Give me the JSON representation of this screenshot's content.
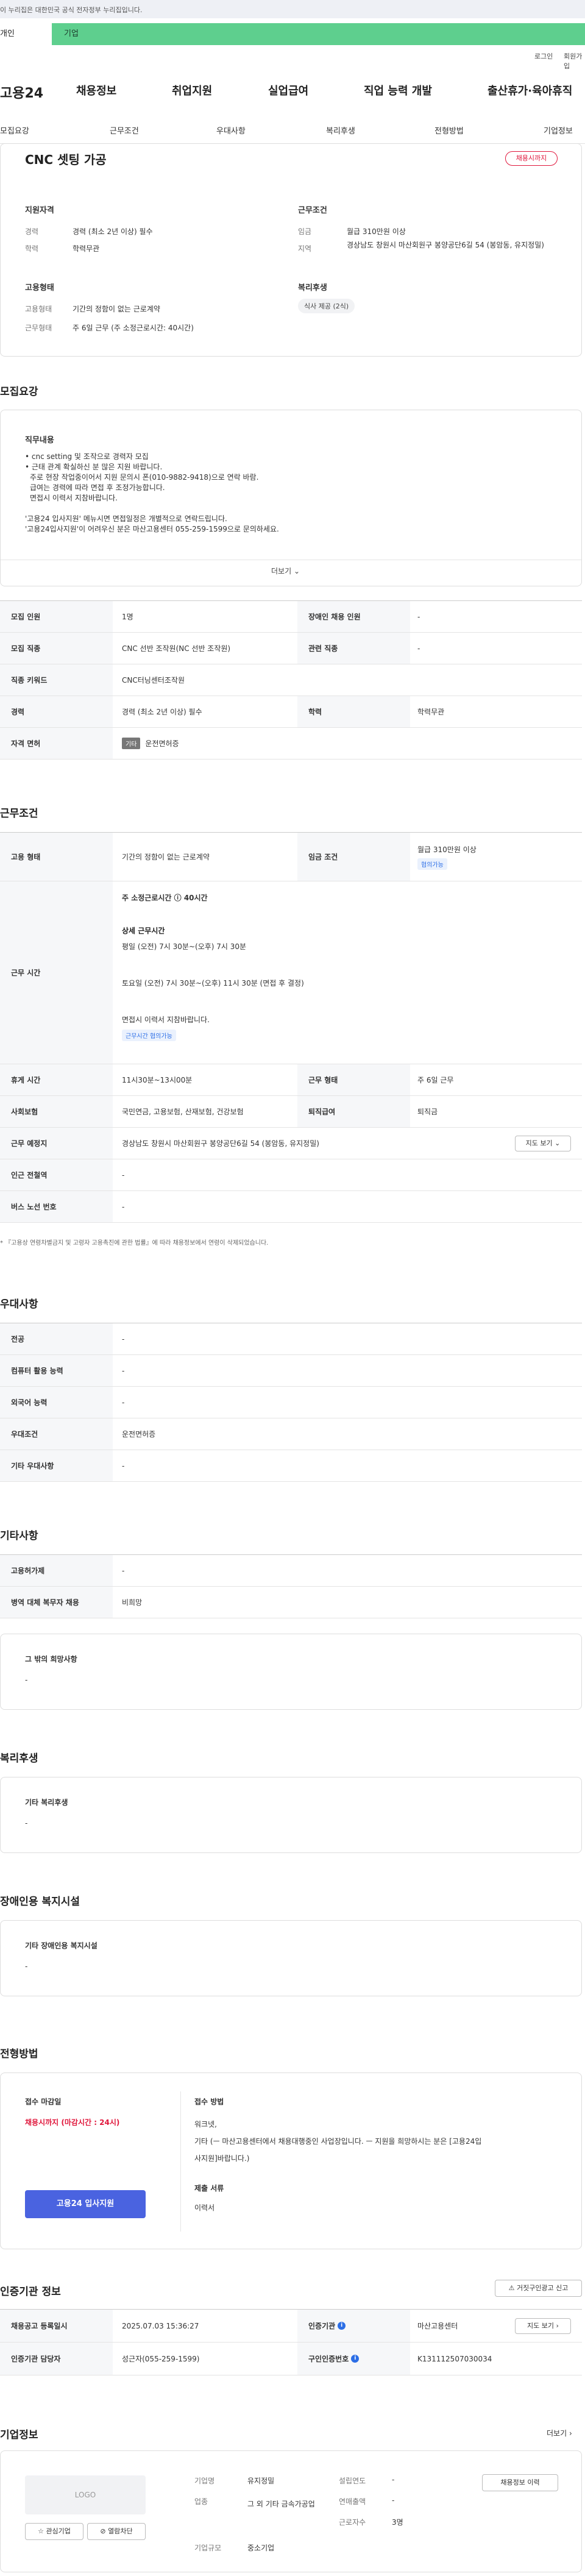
{
  "gov_banner": {
    "text": "이 누리집은 대한민국 공식 전자정부 누리집입니다."
  },
  "segment": {
    "personal": "개인",
    "company": "기업"
  },
  "util": {
    "login": "로그인",
    "join": "회원가입"
  },
  "logo": {
    "text": "고용24"
  },
  "gnb": [
    "채용정보",
    "취업지원",
    "실업급여",
    "직업 능력 개발",
    "출산휴가·육아휴직"
  ],
  "lnb": [
    "모집요강",
    "근무조건",
    "우대사항",
    "복리후생",
    "전형방법",
    "기업정보"
  ],
  "summary": {
    "title": "CNC 셋팅 가공",
    "status_badge": "채용시까지",
    "qual_title": "지원자격",
    "career_label": "경력",
    "career_value": "경력 (최소 2년 이상) 필수",
    "edu_label": "학력",
    "edu_value": "학력무관",
    "cond_title": "근무조건",
    "wage_label": "임금",
    "wage_value": "월급 310만원 이상",
    "region_label": "지역",
    "region_value": "경상남도 창원시 마산회원구 봉양공단6길 54 (봉암동, 유지정밀)",
    "emp_title": "고용형태",
    "emptype_label": "고용형태",
    "emptype_value": "기간의 정함이 없는 근로계약",
    "worktype_label": "근무형태",
    "worktype_value": "주 6일 근무 (주 소정근로시간: 40시간)",
    "welfare_title": "복리후생",
    "welfare_chip": "식사 제공 (2식)"
  },
  "recruit": {
    "heading": "모집요강",
    "duty_title": "직무내용",
    "duty_lines": [
      "• cnc setting 및 조작으로 경력자 모집",
      "• 근태 관계 확실하신 분 많은 지원 바랍니다.",
      "  주로 현장 작업중이어서 지원 문의시 폰(010-9882-9418)으로 연락 바람.",
      "  급여는 경력에 따라 면접 후 조정가능합니다.",
      "  면접시 이력서 지참바랍니다.",
      "",
      "'고용24 입사지원' 메뉴시면 면접일정은 개별적으로 연락드립니다.",
      "'고용24입사지원'이 어려우신 분은 마산고용센터 055-259-1599으로 문의하세요."
    ],
    "more": "더보기",
    "rows": [
      {
        "h1": "모집 인원",
        "v1": "1명",
        "h2": "장애인 채용 인원",
        "v2": "-"
      },
      {
        "h1": "모집 직종",
        "v1": "CNC 선반 조작원(NC 선반 조작원)",
        "h2": "관련 직종",
        "v2": "-"
      },
      {
        "h1": "직종 키워드",
        "v1": "CNC터닝센터조작원"
      },
      {
        "h1": "경력",
        "v1": "경력 (최소 2년 이상) 필수",
        "h2": "학력",
        "v2": "학력무관"
      },
      {
        "h1": "자격 면허",
        "badge": "기타",
        "v1": "운전면허증"
      }
    ]
  },
  "conditions": {
    "heading": "근무조건",
    "emptype_label": "고용 형태",
    "emptype_value": "기간의 정함이 없는 근로계약",
    "wage_label": "임금 조건",
    "wage_value": "월급 310만원 이상",
    "wage_chip": "협의가능",
    "hours_label": "근무 시간",
    "hours_weekly": "주 소정근로시간 ⓘ 40시간",
    "hours_detail_title": "상세 근무시간",
    "hours_weekday": "평일 (오전) 7시 30분~(오후) 7시 30분",
    "hours_sat": "토요일 (오전) 7시 30분~(오후) 11시 30분 (면접 후 결정)",
    "hours_note": "면접시 이력서 지참바랍니다.",
    "hours_chip": "근무시간 협의가능",
    "break_label": "휴게 시간",
    "break_value": "11시30분~13시00분",
    "worktype_label": "근무 형태",
    "worktype_value": "주 6일 근무",
    "insurance_label": "사회보험",
    "insurance_value": "국민연금, 고용보험, 산재보험, 건강보험",
    "retire_label": "퇴직급여",
    "retire_value": "퇴직금",
    "place_label": "근무 예정지",
    "place_value": "경상남도 창원시 마산회원구 봉양공단6길 54 (봉암동, 유지정밀)",
    "map_btn": "지도 보기",
    "station_label": "인근 전철역",
    "station_value": "-",
    "bus_label": "버스 노선 번호",
    "bus_value": "-",
    "footnote": "* 『고용상 연령차별금지 및 고령자 고용촉진에 관한 법률』에 따라 채용정보에서 연령이 삭제되었습니다."
  },
  "preference": {
    "heading": "우대사항",
    "rows": [
      {
        "h": "전공",
        "v": "-"
      },
      {
        "h": "컴퓨터 활용 능력",
        "v": "-"
      },
      {
        "h": "외국어 능력",
        "v": "-"
      },
      {
        "h": "우대조건",
        "v": "운전면허증"
      },
      {
        "h": "기타 우대사항",
        "v": "-"
      }
    ]
  },
  "etc": {
    "heading": "기타사항",
    "rows": [
      {
        "h": "고용허가제",
        "v": "-"
      },
      {
        "h": "병역 대체 복무자 채용",
        "v": "비희망"
      }
    ],
    "other_title": "그 밖의 희망사항",
    "other_value": "-"
  },
  "welfare": {
    "heading": "복리후생",
    "box_title": "기타 복리후생",
    "box_value": "-"
  },
  "disabled": {
    "heading": "장애인용 복지시설",
    "box_title": "기타 장애인용 복지시설",
    "box_value": "-"
  },
  "screening": {
    "heading": "전형방법",
    "deadline_title": "접수 마감일",
    "deadline_value": "채용시까지 (마감시간 : 24시)",
    "apply_btn": "고용24 입사지원",
    "method_title": "접수 방법",
    "method_lines": [
      "워크넷,",
      "기타 (ㅡ 마산고용센터에서 채용대행중인 사업장입니다.  ㅡ 지원을 희망하시는 분은 [고용24입",
      "사지원]바랍니다.)"
    ],
    "docs_title": "제출 서류",
    "docs_value": "이력서"
  },
  "agency": {
    "heading": "인증기관 정보",
    "report_btn": "거짓구인광고 신고",
    "reg_label": "채용공고 등록일시",
    "reg_value": "2025.07.03 15:36:27",
    "agency_label": "인증기관",
    "agency_value": "마산고용센터",
    "map_btn": "지도 보기",
    "manager_label": "인증기관 담당자",
    "manager_value": "성근자(055-259-1599)",
    "reqno_label": "구인인증번호",
    "reqno_value": "K131112507030034"
  },
  "company": {
    "heading": "기업정보",
    "more": "더보기",
    "logo": "LOGO",
    "fav_btn": "관심기업",
    "block_btn": "열람차단",
    "name_label": "기업명",
    "name_value": "유지정밀",
    "industry_label": "업종",
    "industry_value": "그 외 기타 금속가공업",
    "size_label": "기업규모",
    "size_value": "중소기업",
    "founded_label": "설립연도",
    "founded_value": "-",
    "sales_label": "연매출액",
    "sales_value": "-",
    "staff_label": "근로자수",
    "staff_value": "3명",
    "jobs_btn": "채용정보 이력"
  }
}
